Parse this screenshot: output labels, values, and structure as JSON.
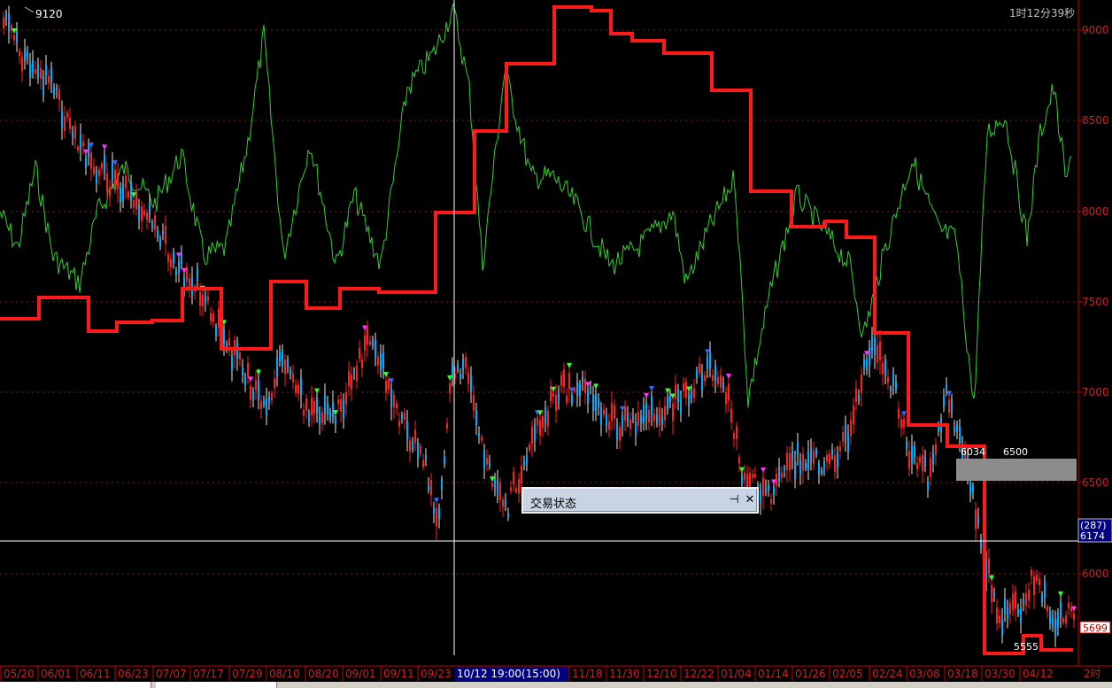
{
  "header": {
    "price_label": "9120",
    "timer": "1时12分39秒"
  },
  "status_panel": {
    "title": "交易状态",
    "pin_icon": "pin-icon",
    "close_icon": "close-icon"
  },
  "right_axis": {
    "ticks": [
      "9000",
      "8500",
      "8000",
      "7500",
      "7000",
      "6500",
      "6000"
    ],
    "cursor_count": "(287)",
    "cursor_price": "6174",
    "last_price": "5699",
    "zone_low": "6034",
    "zone_high": "6500"
  },
  "annotations": {
    "low_mark": "5555"
  },
  "bottom_axis": {
    "dates": [
      "05/20",
      "06/01",
      "06/11",
      "06/23",
      "07/07",
      "07/17",
      "07/29",
      "08/10",
      "08/20",
      "09/01",
      "09/11",
      "09/23",
      "11/18",
      "11/30",
      "12/10",
      "12/22",
      "01/04",
      "01/14",
      "01/26",
      "02/05",
      "02/24",
      "03/08",
      "03/18",
      "03/30",
      "04/12"
    ],
    "cursor_date": "10/12 19:00(15:00)",
    "period": "2时"
  },
  "colors": {
    "background": "#000000",
    "axis": "#cc0000",
    "step_line": "#ff1a1a",
    "oscillator": "#33cc33",
    "candle_up": "#ff2020",
    "candle_down": "#ffffff",
    "cursor": "#ffffff",
    "label_gray": "#c0c0c0",
    "highlight_date": "#0000a0"
  }
}
